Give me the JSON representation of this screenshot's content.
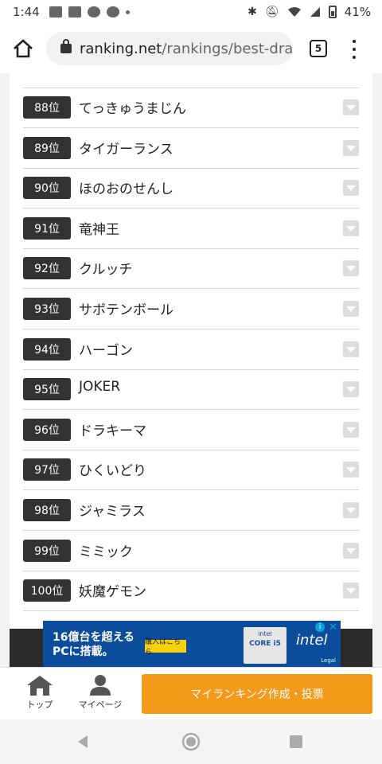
{
  "status": {
    "time": "1:44",
    "battery": "41%"
  },
  "browser": {
    "url_host": "ranking.net",
    "url_path": "/rankings/best-drag",
    "tab_count": "5"
  },
  "ranking": [
    {
      "rank": "88位",
      "name": "てっきゅうまじん"
    },
    {
      "rank": "89位",
      "name": "タイガーランス"
    },
    {
      "rank": "90位",
      "name": "ほのおのせんし"
    },
    {
      "rank": "91位",
      "name": "竜神王"
    },
    {
      "rank": "92位",
      "name": "クルッチ"
    },
    {
      "rank": "93位",
      "name": "サボテンボール"
    },
    {
      "rank": "94位",
      "name": "ハーゴン"
    },
    {
      "rank": "95位",
      "name": "JOKER"
    },
    {
      "rank": "96位",
      "name": "ドラキーマ"
    },
    {
      "rank": "97位",
      "name": "ひくいどり"
    },
    {
      "rank": "98位",
      "name": "ジャミラス"
    },
    {
      "rank": "99位",
      "name": "ミミック"
    },
    {
      "rank": "100位",
      "name": "妖魔ゲモン"
    }
  ],
  "ad": {
    "line1": "16億台を超える",
    "line2": "PCに搭載。",
    "buy_label": "購入はこちら",
    "chip_brand": "intel",
    "chip_core": "CORE i5",
    "logo": "intel",
    "legal": "Legal"
  },
  "bottom_nav": {
    "top_label": "トップ",
    "mypage_label": "マイページ",
    "cta_label": "マイランキング作成・投票"
  }
}
